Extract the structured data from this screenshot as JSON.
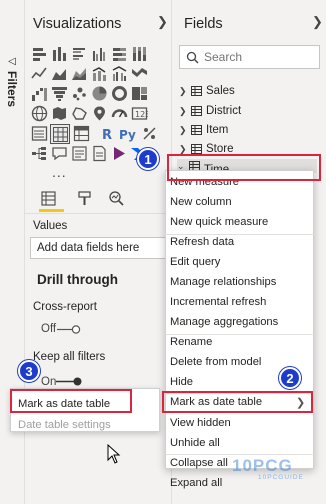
{
  "filters": {
    "label": "Filters"
  },
  "visualizations": {
    "title": "Visualizations",
    "more": "...",
    "values_label": "Values",
    "values_placeholder": "Add data fields here",
    "drill_through_title": "Drill through",
    "cross_report_label": "Cross-report",
    "cross_report_state": "Off",
    "keep_filters_label": "Keep all filters",
    "keep_filters_state": "On"
  },
  "fields": {
    "title": "Fields",
    "search_placeholder": "Search",
    "tables": [
      "Sales",
      "District",
      "Item",
      "Store",
      "Time"
    ]
  },
  "context_menu": {
    "items": [
      "New measure",
      "New column",
      "New quick measure",
      "Refresh data",
      "Edit query",
      "Manage relationships",
      "Incremental refresh",
      "Manage aggregations",
      "Rename",
      "Delete from model",
      "Hide",
      "Mark as date table",
      "View hidden",
      "Unhide all",
      "Collapse all",
      "Expand all"
    ]
  },
  "left_menu": {
    "items": [
      "Mark as date table",
      "Date table settings"
    ]
  },
  "badges": [
    "1",
    "2",
    "3"
  ],
  "watermark": {
    "text": "10PCG",
    "sub": "10PCGUIDE"
  },
  "colors": {
    "highlight": "#d7263d",
    "badge": "#1e3ccc",
    "accent": "#f2c811"
  }
}
